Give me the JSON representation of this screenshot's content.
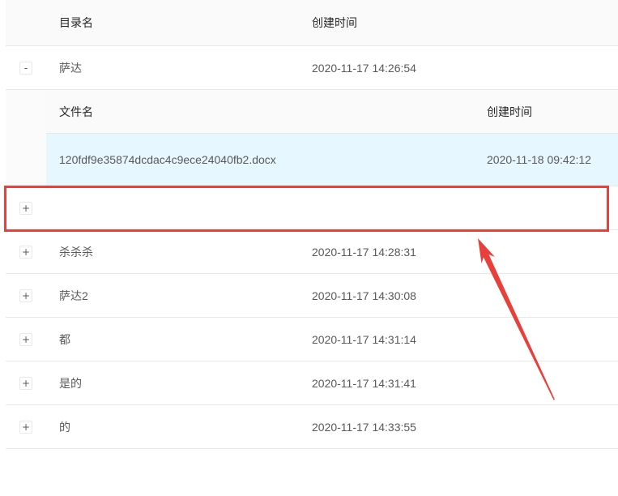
{
  "table": {
    "columns": {
      "name": "目录名",
      "created": "创建时间"
    },
    "rows": [
      {
        "toggle": "-",
        "name": "萨达",
        "created": "2020-11-17 14:26:54",
        "expanded": true,
        "files": {
          "columns": {
            "name": "文件名",
            "created": "创建时间"
          },
          "rows": [
            {
              "name": "120fdf9e35874dcdac4c9ece24040fb2.docx",
              "created": "2020-11-18 09:42:12",
              "highlighted": true
            }
          ]
        }
      },
      {
        "toggle": "+",
        "name": "",
        "created": ""
      },
      {
        "toggle": "+",
        "name": "杀杀杀",
        "created": "2020-11-17 14:28:31"
      },
      {
        "toggle": "+",
        "name": "萨达2",
        "created": "2020-11-17 14:30:08"
      },
      {
        "toggle": "+",
        "name": "都",
        "created": "2020-11-17 14:31:14"
      },
      {
        "toggle": "+",
        "name": "是的",
        "created": "2020-11-17 14:31:41"
      },
      {
        "toggle": "+",
        "name": "的",
        "created": "2020-11-17 14:33:55"
      }
    ]
  },
  "theme": {
    "header_bg": "#fafafa",
    "highlight_row_bg": "#e6f7ff"
  },
  "annotation": {
    "color": "#e8403a"
  }
}
